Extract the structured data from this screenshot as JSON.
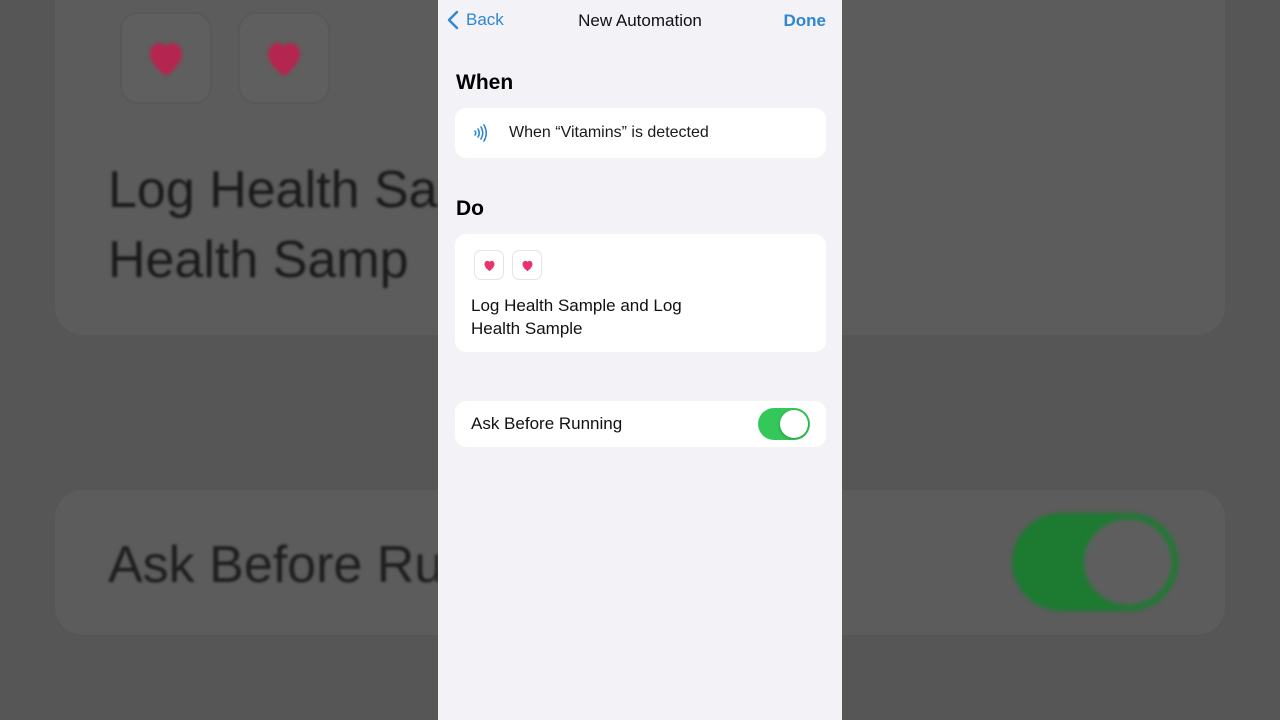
{
  "background": {
    "title_line1": "Log Health Sa",
    "title_line2": "Health Samp",
    "ask_label": "Ask Before Ru"
  },
  "nav": {
    "back_label": "Back",
    "title": "New Automation",
    "done_label": "Done"
  },
  "when": {
    "header": "When",
    "trigger_text": "When “Vitamins” is detected",
    "trigger_icon": "nfc-icon"
  },
  "do": {
    "header": "Do",
    "action_icons": [
      "heart-icon",
      "heart-icon"
    ],
    "summary": "Log Health Sample and Log Health Sample"
  },
  "ask_before_running": {
    "label": "Ask Before Running",
    "enabled": true
  },
  "colors": {
    "accent": "#2f87d1",
    "toggle_on": "#34c759",
    "heart": "#e8336d",
    "background": "#f2f2f7"
  }
}
